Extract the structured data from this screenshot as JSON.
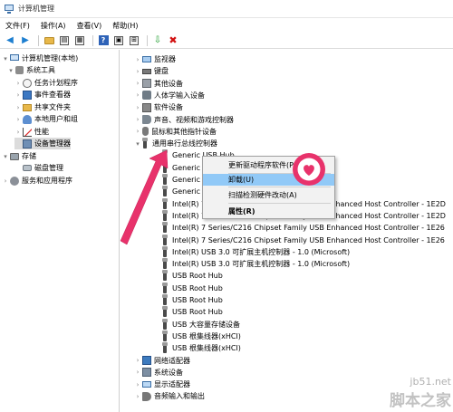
{
  "window": {
    "title": "计算机管理"
  },
  "menu": [
    "文件(F)",
    "操作(A)",
    "查看(V)",
    "帮助(H)"
  ],
  "left_tree": [
    {
      "label": "计算机管理(本地)",
      "icon": "computer-icon",
      "expander": "▾"
    },
    {
      "label": "系统工具",
      "icon": "tools-icon",
      "expander": "▾"
    },
    {
      "label": "任务计划程序",
      "icon": "task-scheduler-icon",
      "expander": "›"
    },
    {
      "label": "事件查看器",
      "icon": "event-viewer-icon",
      "expander": "›"
    },
    {
      "label": "共享文件夹",
      "icon": "shared-folder-icon",
      "expander": "›"
    },
    {
      "label": "本地用户和组",
      "icon": "users-icon",
      "expander": "›"
    },
    {
      "label": "性能",
      "icon": "performance-icon",
      "expander": "›"
    },
    {
      "label": "设备管理器",
      "icon": "device-manager-icon",
      "expander": "",
      "selected": true
    },
    {
      "label": "存储",
      "icon": "storage-icon",
      "expander": "▾"
    },
    {
      "label": "磁盘管理",
      "icon": "disk-icon",
      "expander": ""
    },
    {
      "label": "服务和应用程序",
      "icon": "services-icon",
      "expander": "›"
    }
  ],
  "device_tree": [
    {
      "label": "监视器",
      "icon": "monitor-icon",
      "expander": "›"
    },
    {
      "label": "键盘",
      "icon": "keyboard-icon",
      "expander": "›"
    },
    {
      "label": "其他设备",
      "icon": "other-device-icon",
      "expander": "›"
    },
    {
      "label": "人体学输入设备",
      "icon": "hid-icon",
      "expander": "›"
    },
    {
      "label": "软件设备",
      "icon": "software-icon",
      "expander": "›"
    },
    {
      "label": "声音、视频和游戏控制器",
      "icon": "audio-icon",
      "expander": "›"
    },
    {
      "label": "鼠标和其他指针设备",
      "icon": "mouse-icon",
      "expander": "›"
    },
    {
      "label": "通用串行总线控制器",
      "icon": "usb-controller-icon",
      "expander": "▾"
    },
    {
      "label": "Generic USB Hub",
      "icon": "usb-icon",
      "expander": ""
    },
    {
      "label": "Generic USB Hub",
      "icon": "usb-icon",
      "expander": ""
    },
    {
      "label": "Generic USB Hub",
      "icon": "usb-icon",
      "expander": ""
    },
    {
      "label": "Generic USB Hub",
      "icon": "usb-icon",
      "expander": ""
    },
    {
      "label": "Intel(R) 7 Series/C216 Chipset Family USB Enhanced Host Controller - 1E2D",
      "icon": "usb-icon",
      "expander": ""
    },
    {
      "label": "Intel(R) 7 Series/C216 Chipset Family USB Enhanced Host Controller - 1E2D",
      "icon": "usb-icon",
      "expander": ""
    },
    {
      "label": "Intel(R) 7 Series/C216 Chipset Family USB Enhanced Host Controller - 1E26",
      "icon": "usb-icon",
      "expander": ""
    },
    {
      "label": "Intel(R) 7 Series/C216 Chipset Family USB Enhanced Host Controller - 1E26",
      "icon": "usb-icon",
      "expander": ""
    },
    {
      "label": "Intel(R) USB 3.0 可扩展主机控制器 - 1.0 (Microsoft)",
      "icon": "usb-icon",
      "expander": ""
    },
    {
      "label": "Intel(R) USB 3.0 可扩展主机控制器 - 1.0 (Microsoft)",
      "icon": "usb-icon",
      "expander": ""
    },
    {
      "label": "USB Root Hub",
      "icon": "usb-icon",
      "expander": ""
    },
    {
      "label": "USB Root Hub",
      "icon": "usb-icon",
      "expander": ""
    },
    {
      "label": "USB Root Hub",
      "icon": "usb-icon",
      "expander": ""
    },
    {
      "label": "USB Root Hub",
      "icon": "usb-icon",
      "expander": ""
    },
    {
      "label": "USB 大容量存储设备",
      "icon": "usb-icon",
      "expander": ""
    },
    {
      "label": "USB 根集线器(xHCI)",
      "icon": "usb-icon",
      "expander": ""
    },
    {
      "label": "USB 根集线器(xHCI)",
      "icon": "usb-icon",
      "expander": ""
    },
    {
      "label": "网络适配器",
      "icon": "network-icon",
      "expander": "›"
    },
    {
      "label": "系统设备",
      "icon": "system-device-icon",
      "expander": "›"
    },
    {
      "label": "显示适配器",
      "icon": "display-adapter-icon",
      "expander": "›"
    },
    {
      "label": "音频输入和输出",
      "icon": "audio-io-icon",
      "expander": "›"
    }
  ],
  "context_menu": [
    {
      "label": "更新驱动程序软件(P)...",
      "highlighted": false,
      "bold": false
    },
    {
      "label": "卸载(U)",
      "highlighted": true,
      "bold": false
    },
    {
      "label": "扫描检测硬件改动(A)",
      "highlighted": false,
      "bold": false
    },
    {
      "label": "属性(R)",
      "highlighted": false,
      "bold": true
    }
  ],
  "watermark": {
    "line1": "jb51.net",
    "line2": "脚本之家"
  },
  "colors": {
    "highlight": "#91c9f7",
    "arrow": "#e8326b",
    "selection": "#dcdcdc"
  }
}
